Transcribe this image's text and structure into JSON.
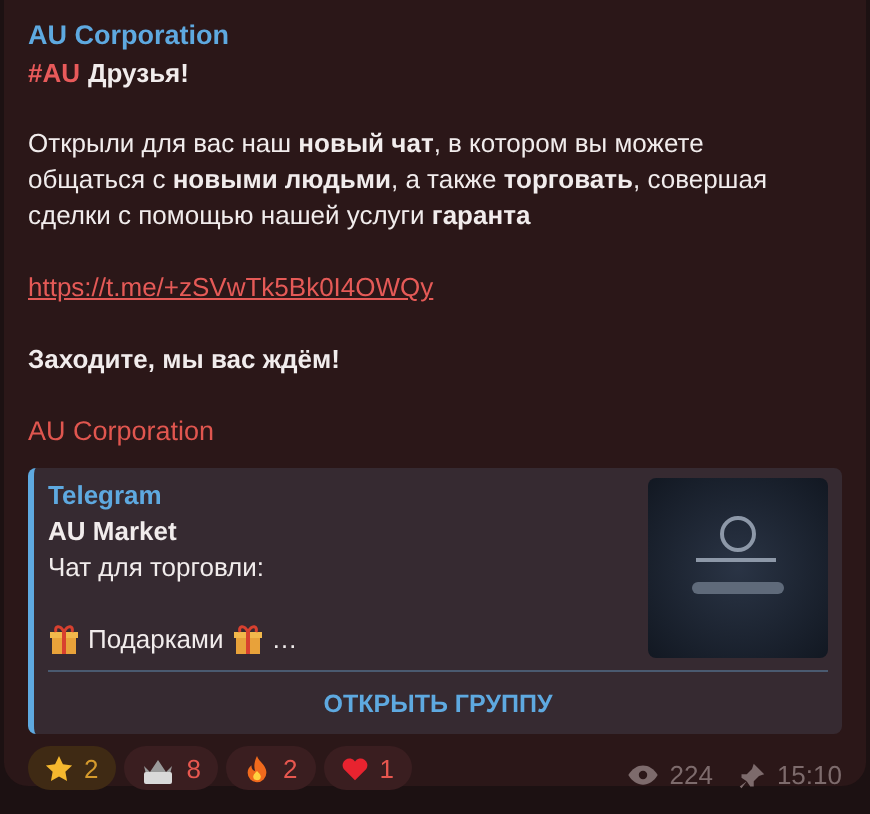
{
  "message": {
    "author": "AU Corporation",
    "hashtag": "#AU",
    "greeting": "Друзья!",
    "paragraph": "Открыли для вас наш **новый чат**, в котором вы можете общаться с **новыми людьми**, а также **торговать**, совершая сделки с помощью нашей услуги **гаранта**",
    "link": "https://t.me/+zSVwTk5Bk0I4OWQy",
    "closing": "Заходите, мы вас ждём!",
    "signature": "AU Corporation"
  },
  "preview": {
    "site": "Telegram",
    "title": "AU Market",
    "description": "Чат для торговли:",
    "teaser": "Подарками",
    "ellipsis": "…",
    "button": "ОТКРЫТЬ ГРУППУ"
  },
  "reactions": [
    {
      "kind": "star",
      "count": "2"
    },
    {
      "kind": "crown",
      "count": "8"
    },
    {
      "kind": "fire",
      "count": "2"
    },
    {
      "kind": "heart",
      "count": "1"
    }
  ],
  "views": "224",
  "time": "15:10"
}
